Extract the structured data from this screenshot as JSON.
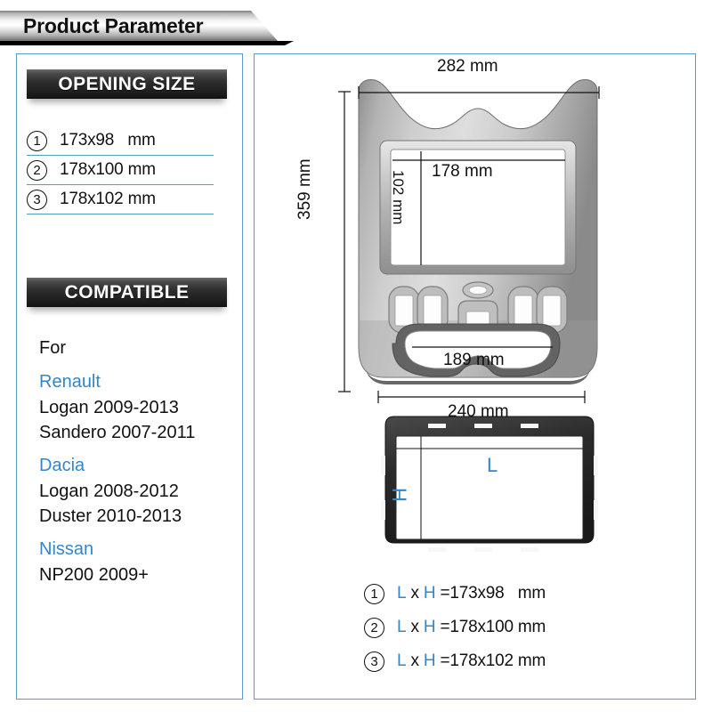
{
  "header": {
    "title": "Product Parameter"
  },
  "left_panel": {
    "opening_size": {
      "heading": "OPENING SIZE",
      "rows": [
        {
          "num": "1",
          "value": "173x98   mm"
        },
        {
          "num": "2",
          "value": "178x100 mm"
        },
        {
          "num": "3",
          "value": "178x102 mm"
        }
      ]
    },
    "compatible": {
      "heading": "COMPATIBLE",
      "for_label": "For",
      "groups": [
        {
          "brand": "Renault",
          "models": [
            "Logan 2009-2013",
            "Sandero 2007-2011"
          ]
        },
        {
          "brand": "Dacia",
          "models": [
            "Logan 2008-2012",
            "Duster 2010-2013"
          ]
        },
        {
          "brand": "Nissan",
          "models": [
            "NP200 2009+"
          ]
        }
      ]
    }
  },
  "right_panel": {
    "fascia_dimensions": {
      "top_width": "282 mm",
      "left_height": "359 mm",
      "opening_width": "178 mm",
      "opening_height": "102 mm",
      "lower_opening_width": "189 mm",
      "bottom_width": "240 mm"
    },
    "bezel_labels": {
      "length": "L",
      "height": "H"
    },
    "lh_list": [
      {
        "num": "1",
        "l": "L",
        "x": " x ",
        "h": "H",
        "eq": " =173x98   mm"
      },
      {
        "num": "2",
        "l": "L",
        "x": " x ",
        "h": "H",
        "eq": " =178x100 mm"
      },
      {
        "num": "3",
        "l": "L",
        "x": " x ",
        "h": "H",
        "eq": " =178x102 mm"
      }
    ]
  },
  "colors": {
    "accent_blue": "#3386cc",
    "panel_border": "#5b9bc9",
    "rule_teal": "#4f9fc0",
    "text_dark": "#111111"
  }
}
